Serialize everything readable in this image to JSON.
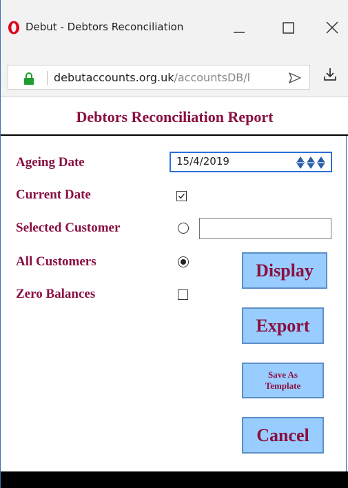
{
  "window": {
    "title": "Debut - Debtors Reconciliation",
    "minimize_icon": "minimize-icon",
    "maximize_icon": "maximize-icon",
    "close_icon": "close-icon"
  },
  "address_bar": {
    "url_host": "debutaccounts.org.uk",
    "url_path": "/accountsDB/l",
    "lock_icon": "lock-icon",
    "send_icon": "send-icon",
    "download_icon": "download-icon"
  },
  "page": {
    "title": "Debtors Reconciliation Report"
  },
  "form": {
    "ageing_date_label": "Ageing Date",
    "ageing_date_value": "15/4/2019",
    "current_date_label": "Current Date",
    "current_date_checked": true,
    "selected_customer_label": "Selected Customer",
    "selected_customer_value": "",
    "all_customers_label": "All Customers",
    "all_customers_selected": true,
    "zero_balances_label": "Zero Balances",
    "zero_balances_checked": false
  },
  "buttons": {
    "display": "Display",
    "export": "Export",
    "save_template": "Save As\nTemplate",
    "cancel": "Cancel"
  },
  "colors": {
    "label": "#8a1040",
    "button_bg": "#99ccff",
    "accent": "#2d6fd6"
  }
}
